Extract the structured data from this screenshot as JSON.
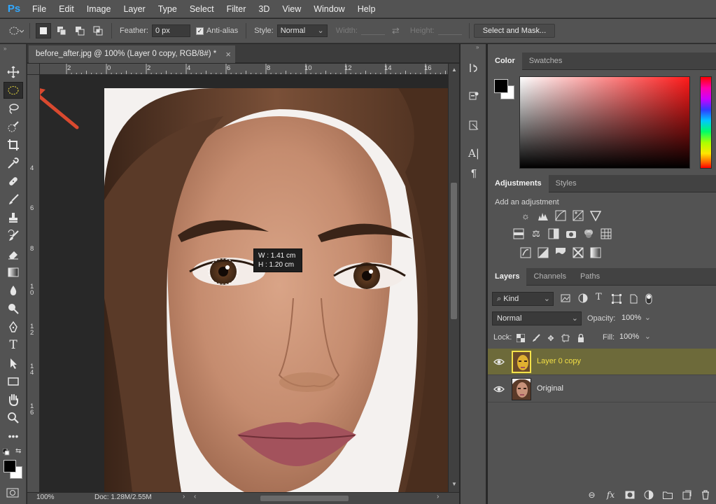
{
  "app": {
    "logo": "Ps"
  },
  "menu": [
    "File",
    "Edit",
    "Image",
    "Layer",
    "Type",
    "Select",
    "Filter",
    "3D",
    "View",
    "Window",
    "Help"
  ],
  "options": {
    "feather_label": "Feather:",
    "feather_value": "0 px",
    "antialias_label": "Anti-alias",
    "antialias_checked": true,
    "style_label": "Style:",
    "style_value": "Normal",
    "width_label": "Width:",
    "height_label": "Height:",
    "select_mask": "Select and Mask..."
  },
  "document": {
    "tab_title": "before_after.jpg @ 100% (Layer 0 copy, RGB/8#) *",
    "zoom": "100%",
    "doc_info": "Doc: 1.28M/2.55M",
    "ruler_top": [
      "2",
      "0",
      "2",
      "4",
      "6",
      "8",
      "10",
      "12",
      "14",
      "16"
    ],
    "ruler_left": [
      "4",
      "6",
      "8",
      "1\n0",
      "1\n2",
      "1\n4",
      "1\n6"
    ]
  },
  "tooltip": {
    "w_line": "W :  1.41 cm",
    "h_line": "H :  1.20 cm"
  },
  "panels": {
    "color_tabs": [
      "Color",
      "Swatches"
    ],
    "adjust_tabs": [
      "Adjustments",
      "Styles"
    ],
    "adjust_heading": "Add an adjustment",
    "layers_tabs": [
      "Layers",
      "Channels",
      "Paths"
    ],
    "kind_label": "Kind",
    "blend_mode": "Normal",
    "opacity_label": "Opacity:",
    "opacity_value": "100%",
    "lock_label": "Lock:",
    "fill_label": "Fill:",
    "fill_value": "100%",
    "layers": [
      {
        "name": "Layer 0 copy",
        "selected": true
      },
      {
        "name": "Original",
        "selected": false
      }
    ]
  },
  "colors": {
    "accent_selected_layer": "#6d6a3a",
    "layer_name_selected": "#f2df45",
    "arrow_annotation": "#d9492f"
  }
}
